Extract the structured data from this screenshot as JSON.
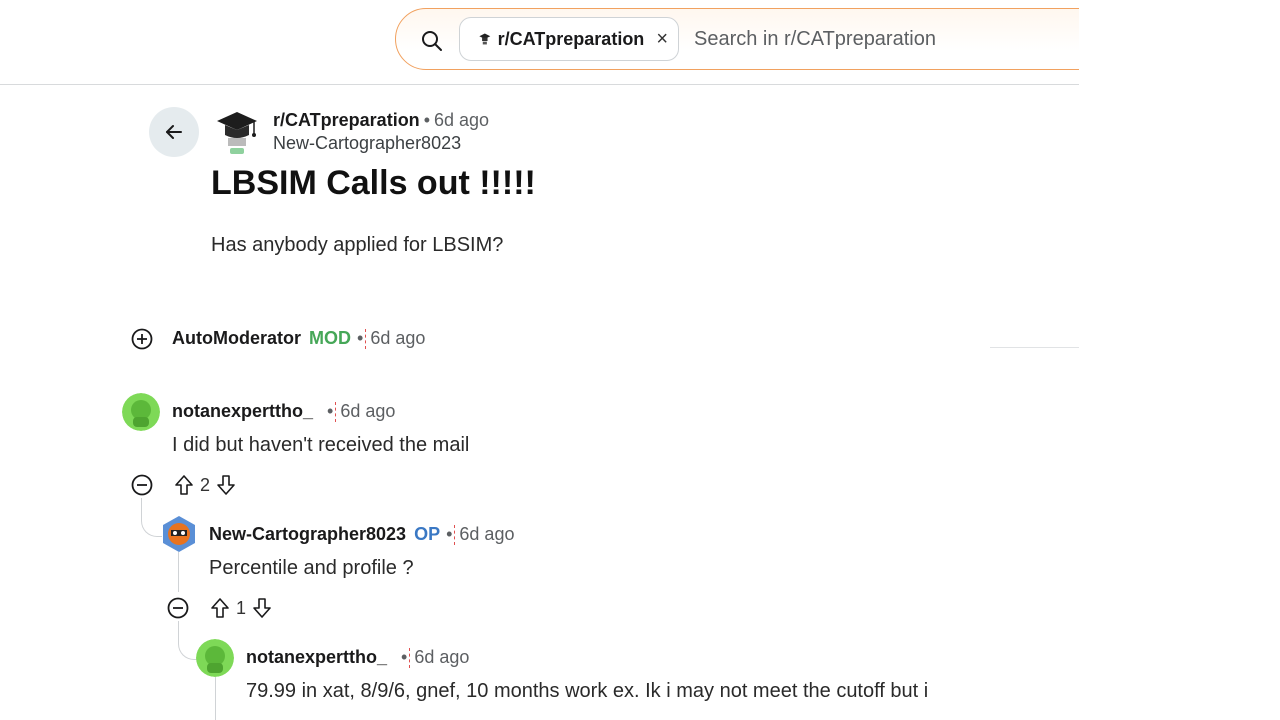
{
  "search": {
    "chip_label": "r/CATpreparation",
    "chip_close": "×",
    "placeholder": "Search in r/CATpreparation"
  },
  "post": {
    "subreddit": "r/CATpreparation",
    "dot": "•",
    "time": "6d ago",
    "author": "New-Cartographer8023",
    "title": "LBSIM Calls out !!!!!",
    "body": "Has anybody applied for LBSIM?"
  },
  "comments": [
    {
      "username": "AutoModerator",
      "badge": "MOD",
      "dot": "•",
      "time": "6d ago"
    },
    {
      "username": "notanexperttho_",
      "dot": "•",
      "time": "6d ago",
      "text": "I did but haven't received the mail",
      "votes": "2"
    },
    {
      "username": "New-Cartographer8023",
      "badge": "OP",
      "dot": "•",
      "time": "6d ago",
      "text": "Percentile and profile ?",
      "votes": "1"
    },
    {
      "username": "notanexperttho_",
      "dot": "•",
      "time": "6d ago",
      "text": "79.99 in xat, 8/9/6, gnef, 10 months work ex. Ik i may not meet the cutoff but i"
    }
  ],
  "icons": {
    "search": "search-icon",
    "back": "arrow-left-icon",
    "expand": "plus-circle-icon",
    "collapse": "minus-circle-icon",
    "upvote": "arrow-up-icon",
    "downvote": "arrow-down-icon"
  },
  "colors": {
    "mod_badge": "#46a758",
    "op_badge": "#3a78c4",
    "search_border": "#f1a15f"
  }
}
